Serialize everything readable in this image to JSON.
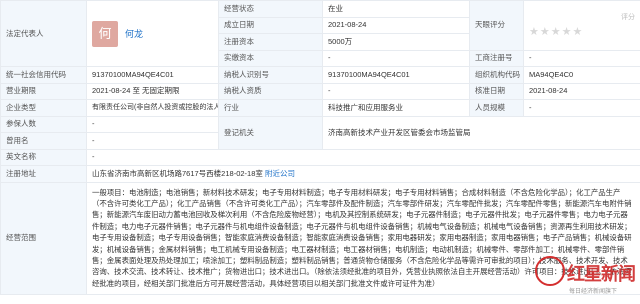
{
  "legal_rep": {
    "label": "法定代表人",
    "avatar_char": "何",
    "name": "何龙"
  },
  "op_status": {
    "label": "经营状态",
    "value": "在业"
  },
  "established": {
    "label": "成立日期",
    "value": "2021-08-24"
  },
  "reg_capital": {
    "label": "注册资本",
    "value": "5000万"
  },
  "paid_capital": {
    "label": "实缴资本",
    "value": "-"
  },
  "tianyan": {
    "label": "天眼评分",
    "text": "评分"
  },
  "biz_reg_no": {
    "label": "工商注册号",
    "value": "-"
  },
  "credit_code": {
    "label": "统一社会信用代码",
    "value": "91370100MA94QE4C01"
  },
  "tax_id": {
    "label": "纳税人识别号",
    "value": "91370100MA94QE4C01"
  },
  "org_code": {
    "label": "组织机构代码",
    "value": "MA94QE4C0"
  },
  "term": {
    "label": "营业期限",
    "value": "2021-08-24 至 无固定期限"
  },
  "taxpayer_q": {
    "label": "纳税人资质",
    "value": "-"
  },
  "approval": {
    "label": "核准日期",
    "value": "2021-08-24"
  },
  "ent_type": {
    "label": "企业类型",
    "value": "有限责任公司(非自然人投资或控股的法人独资)"
  },
  "industry": {
    "label": "行业",
    "value": "科技推广和应用服务业"
  },
  "staff": {
    "label": "人员规模",
    "value": "-"
  },
  "insured": {
    "label": "参保人数",
    "value": "-"
  },
  "reg_auth": {
    "label": "登记机关",
    "value": "济南高新技术产业开发区管委会市场监管局"
  },
  "used_name": {
    "label": "曾用名",
    "value": "-"
  },
  "en_name": {
    "label": "英文名称",
    "value": "-"
  },
  "address": {
    "label": "注册地址",
    "value": "山东省济南市高新区机场路7617号西楼218-02-18室",
    "link": "附近公司"
  },
  "scope": {
    "label": "经营范围",
    "value": "一般项目：电池制造；电池销售；新材料技术研发；电子专用材料制造；电子专用材料研发；电子专用材料销售；合成材料制造（不含危险化学品）；化工产品生产（不含许可类化工产品）；化工产品销售（不含许可类化工产品）；汽车零部件及配件制造；汽车零部件研发；汽车零配件批发；汽车零配件零售；新能源汽车电附件销售；新能源汽车废旧动力蓄电池回收及梯次利用（不含危险废物经营）；电机及其控制系统研发；电子元器件制造；电子元器件批发；电子元器件零售；电力电子元器件制造；电力电子元器件销售；电子元器件与机电组件设备制造；电子元器件与机电组件设备销售；机械电气设备制造；机械电气设备销售；资源再生利用技术研发；电子专用设备制造；电子专用设备销售；智能家庭消费设备制造；智能家庭消费设备销售；家用电器研发；家用电器制造；家用电器销售；电子产品销售；机械设备研发；机械设备销售；金属材料销售；电工机械专用设备制造；电工器材制造；电工器材销售；电机制造；电动机制造；机械零件、零部件加工；机械零件、零部件销售；金属表面处理及热处理加工；喷涂加工；塑料制品制造；塑料制品销售；普通货物仓储服务（不含危险化学品等需许可审批的项目）；技术服务、技术开发、技术咨询、技术交流、技术转让、技术推广；货物进出口；技术进出口。（除依法须经批准的项目外，凭营业执照依法自主开展经营活动）许可项目：技术进出口。（依法须经批准的项目，经相关部门批准后方可开展经营活动，具体经营项目以相关部门批准文件或许可证件为准）"
  },
  "watermark": {
    "brand": "红星新闻",
    "sub": "每日经济新闻旗下"
  }
}
